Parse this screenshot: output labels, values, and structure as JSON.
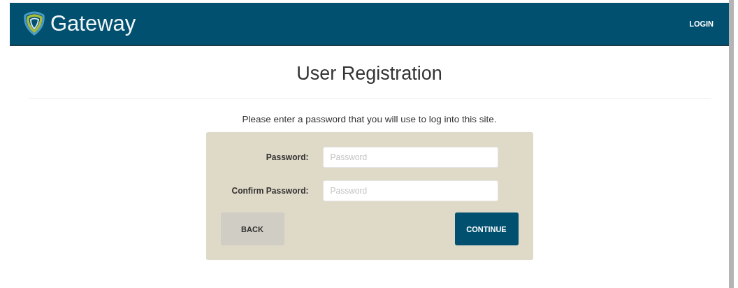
{
  "header": {
    "brand": "Gateway",
    "nav": [
      "LOGIN"
    ]
  },
  "title": "User Registration",
  "instructions": "Please enter a password that you will use to log into this site.",
  "fields": [
    {
      "label": "Password:",
      "placeholder": "Password"
    },
    {
      "label": "Confirm Password:",
      "placeholder": "Password"
    }
  ],
  "buttons": [
    {
      "label": "BACK",
      "kind": "secondary"
    },
    {
      "label": "CONTINUE",
      "kind": "primary"
    }
  ]
}
